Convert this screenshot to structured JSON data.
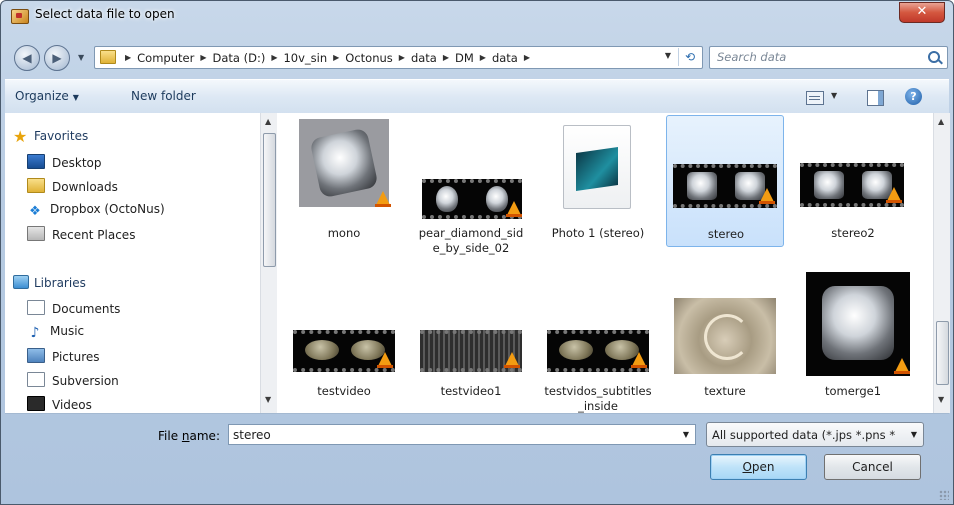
{
  "window": {
    "title": "Select data file to open",
    "close_glyph": "✕"
  },
  "nav": {
    "back_glyph": "◀",
    "forward_glyph": "▶",
    "breadcrumb": [
      "Computer",
      "Data (D:)",
      "10v_sin",
      "Octonus",
      "data",
      "DM",
      "data"
    ],
    "search_placeholder": "Search data"
  },
  "toolbar": {
    "organize": "Organize",
    "new_folder": "New folder",
    "help_glyph": "?"
  },
  "sidebar": {
    "favorites_label": "Favorites",
    "favorites": [
      {
        "label": "Desktop",
        "icon": "desktop-icon"
      },
      {
        "label": "Downloads",
        "icon": "downloads-folder-icon"
      },
      {
        "label": "Dropbox (OctoNus)",
        "icon": "dropbox-icon"
      },
      {
        "label": "Recent Places",
        "icon": "recent-places-icon"
      }
    ],
    "libraries_label": "Libraries",
    "libraries": [
      {
        "label": "Documents",
        "icon": "documents-icon"
      },
      {
        "label": "Music",
        "icon": "music-icon"
      },
      {
        "label": "Pictures",
        "icon": "pictures-icon"
      },
      {
        "label": "Subversion",
        "icon": "subversion-icon"
      },
      {
        "label": "Videos",
        "icon": "videos-icon"
      }
    ]
  },
  "files": [
    {
      "name": "mono",
      "thumbnail": "gem-photo",
      "selected": false
    },
    {
      "name": "pear_diamond_side_by_side_02",
      "thumbnail": "video-film",
      "selected": false
    },
    {
      "name": "Photo 1 (stereo)",
      "thumbnail": "image-document-icon",
      "selected": false
    },
    {
      "name": "stereo",
      "thumbnail": "video-film",
      "selected": true
    },
    {
      "name": "stereo2",
      "thumbnail": "video-film",
      "selected": false
    },
    {
      "name": "testvideo",
      "thumbnail": "video-film",
      "selected": false
    },
    {
      "name": "testvideo1",
      "thumbnail": "video-film",
      "selected": false
    },
    {
      "name": "testvidos_subtitles_inside",
      "thumbnail": "video-film",
      "selected": false
    },
    {
      "name": "texture",
      "thumbnail": "texture-photo",
      "selected": false
    },
    {
      "name": "tomerge1",
      "thumbnail": "gem-photo",
      "selected": false
    }
  ],
  "footer": {
    "file_name_label_pre": "File ",
    "file_name_label_ul": "n",
    "file_name_label_post": "ame:",
    "file_name_value": "stereo",
    "filter_value": "All supported data (*.jps *.pns *",
    "open_ul": "O",
    "open_rest": "pen",
    "cancel": "Cancel"
  },
  "colors": {
    "selection_bg": "#c9e1fb",
    "selection_border": "#7db4eb",
    "accent": "#3c7fb1",
    "vlc_cone": "#f39c12"
  }
}
